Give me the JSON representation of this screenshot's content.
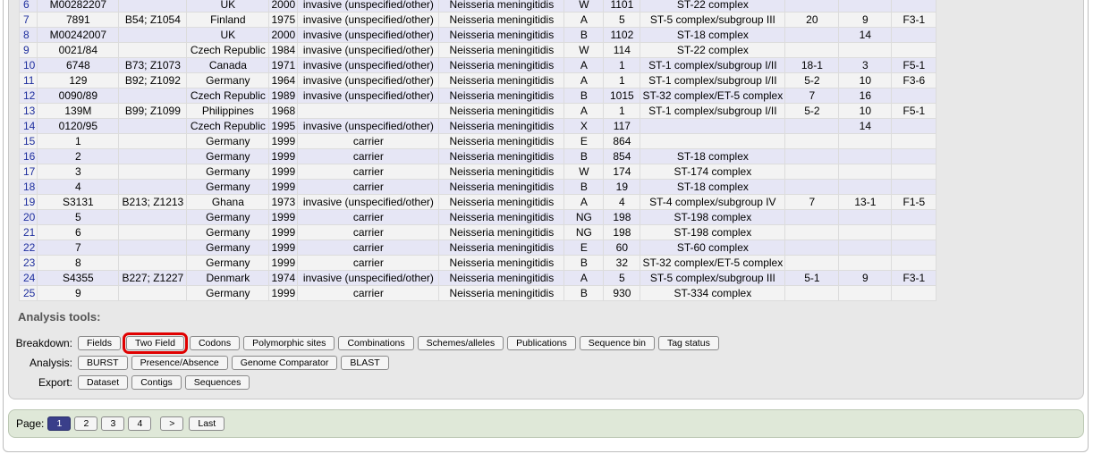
{
  "table": {
    "rows": [
      {
        "idx": "6",
        "id": "M00282207",
        "aliases": "",
        "country": "UK",
        "year": "2000",
        "disease": "invasive (unspecified/other)",
        "species": "Neisseria meningitidis",
        "serogroup": "W",
        "st": "1101",
        "complex": "ST-22 complex",
        "c1": "",
        "c2": "",
        "c3": ""
      },
      {
        "idx": "7",
        "id": "7891",
        "aliases": "B54; Z1054",
        "country": "Finland",
        "year": "1975",
        "disease": "invasive (unspecified/other)",
        "species": "Neisseria meningitidis",
        "serogroup": "A",
        "st": "5",
        "complex": "ST-5 complex/subgroup III",
        "c1": "20",
        "c2": "9",
        "c3": "F3-1"
      },
      {
        "idx": "8",
        "id": "M00242007",
        "aliases": "",
        "country": "UK",
        "year": "2000",
        "disease": "invasive (unspecified/other)",
        "species": "Neisseria meningitidis",
        "serogroup": "B",
        "st": "1102",
        "complex": "ST-18 complex",
        "c1": "",
        "c2": "14",
        "c3": ""
      },
      {
        "idx": "9",
        "id": "0021/84",
        "aliases": "",
        "country": "Czech Republic",
        "year": "1984",
        "disease": "invasive (unspecified/other)",
        "species": "Neisseria meningitidis",
        "serogroup": "W",
        "st": "114",
        "complex": "ST-22 complex",
        "c1": "",
        "c2": "",
        "c3": ""
      },
      {
        "idx": "10",
        "id": "6748",
        "aliases": "B73; Z1073",
        "country": "Canada",
        "year": "1971",
        "disease": "invasive (unspecified/other)",
        "species": "Neisseria meningitidis",
        "serogroup": "A",
        "st": "1",
        "complex": "ST-1 complex/subgroup I/II",
        "c1": "18-1",
        "c2": "3",
        "c3": "F5-1"
      },
      {
        "idx": "11",
        "id": "129",
        "aliases": "B92; Z1092",
        "country": "Germany",
        "year": "1964",
        "disease": "invasive (unspecified/other)",
        "species": "Neisseria meningitidis",
        "serogroup": "A",
        "st": "1",
        "complex": "ST-1 complex/subgroup I/II",
        "c1": "5-2",
        "c2": "10",
        "c3": "F3-6"
      },
      {
        "idx": "12",
        "id": "0090/89",
        "aliases": "",
        "country": "Czech Republic",
        "year": "1989",
        "disease": "invasive (unspecified/other)",
        "species": "Neisseria meningitidis",
        "serogroup": "B",
        "st": "1015",
        "complex": "ST-32 complex/ET-5 complex",
        "c1": "7",
        "c2": "16",
        "c3": ""
      },
      {
        "idx": "13",
        "id": "139M",
        "aliases": "B99; Z1099",
        "country": "Philippines",
        "year": "1968",
        "disease": "",
        "species": "Neisseria meningitidis",
        "serogroup": "A",
        "st": "1",
        "complex": "ST-1 complex/subgroup I/II",
        "c1": "5-2",
        "c2": "10",
        "c3": "F5-1"
      },
      {
        "idx": "14",
        "id": "0120/95",
        "aliases": "",
        "country": "Czech Republic",
        "year": "1995",
        "disease": "invasive (unspecified/other)",
        "species": "Neisseria meningitidis",
        "serogroup": "X",
        "st": "117",
        "complex": "",
        "c1": "",
        "c2": "14",
        "c3": ""
      },
      {
        "idx": "15",
        "id": "1",
        "aliases": "",
        "country": "Germany",
        "year": "1999",
        "disease": "carrier",
        "species": "Neisseria meningitidis",
        "serogroup": "E",
        "st": "864",
        "complex": "",
        "c1": "",
        "c2": "",
        "c3": ""
      },
      {
        "idx": "16",
        "id": "2",
        "aliases": "",
        "country": "Germany",
        "year": "1999",
        "disease": "carrier",
        "species": "Neisseria meningitidis",
        "serogroup": "B",
        "st": "854",
        "complex": "ST-18 complex",
        "c1": "",
        "c2": "",
        "c3": ""
      },
      {
        "idx": "17",
        "id": "3",
        "aliases": "",
        "country": "Germany",
        "year": "1999",
        "disease": "carrier",
        "species": "Neisseria meningitidis",
        "serogroup": "W",
        "st": "174",
        "complex": "ST-174 complex",
        "c1": "",
        "c2": "",
        "c3": ""
      },
      {
        "idx": "18",
        "id": "4",
        "aliases": "",
        "country": "Germany",
        "year": "1999",
        "disease": "carrier",
        "species": "Neisseria meningitidis",
        "serogroup": "B",
        "st": "19",
        "complex": "ST-18 complex",
        "c1": "",
        "c2": "",
        "c3": ""
      },
      {
        "idx": "19",
        "id": "S3131",
        "aliases": "B213; Z1213",
        "country": "Ghana",
        "year": "1973",
        "disease": "invasive (unspecified/other)",
        "species": "Neisseria meningitidis",
        "serogroup": "A",
        "st": "4",
        "complex": "ST-4 complex/subgroup IV",
        "c1": "7",
        "c2": "13-1",
        "c3": "F1-5"
      },
      {
        "idx": "20",
        "id": "5",
        "aliases": "",
        "country": "Germany",
        "year": "1999",
        "disease": "carrier",
        "species": "Neisseria meningitidis",
        "serogroup": "NG",
        "st": "198",
        "complex": "ST-198 complex",
        "c1": "",
        "c2": "",
        "c3": ""
      },
      {
        "idx": "21",
        "id": "6",
        "aliases": "",
        "country": "Germany",
        "year": "1999",
        "disease": "carrier",
        "species": "Neisseria meningitidis",
        "serogroup": "NG",
        "st": "198",
        "complex": "ST-198 complex",
        "c1": "",
        "c2": "",
        "c3": ""
      },
      {
        "idx": "22",
        "id": "7",
        "aliases": "",
        "country": "Germany",
        "year": "1999",
        "disease": "carrier",
        "species": "Neisseria meningitidis",
        "serogroup": "E",
        "st": "60",
        "complex": "ST-60 complex",
        "c1": "",
        "c2": "",
        "c3": ""
      },
      {
        "idx": "23",
        "id": "8",
        "aliases": "",
        "country": "Germany",
        "year": "1999",
        "disease": "carrier",
        "species": "Neisseria meningitidis",
        "serogroup": "B",
        "st": "32",
        "complex": "ST-32 complex/ET-5 complex",
        "c1": "",
        "c2": "",
        "c3": ""
      },
      {
        "idx": "24",
        "id": "S4355",
        "aliases": "B227; Z1227",
        "country": "Denmark",
        "year": "1974",
        "disease": "invasive (unspecified/other)",
        "species": "Neisseria meningitidis",
        "serogroup": "A",
        "st": "5",
        "complex": "ST-5 complex/subgroup III",
        "c1": "5-1",
        "c2": "9",
        "c3": "F3-1"
      },
      {
        "idx": "25",
        "id": "9",
        "aliases": "",
        "country": "Germany",
        "year": "1999",
        "disease": "carrier",
        "species": "Neisseria meningitidis",
        "serogroup": "B",
        "st": "930",
        "complex": "ST-334 complex",
        "c1": "",
        "c2": "",
        "c3": ""
      }
    ]
  },
  "tools": {
    "title": "Analysis tools:",
    "breakdown": {
      "label": "Breakdown:",
      "buttons": [
        "Fields",
        "Two Field",
        "Codons",
        "Polymorphic sites",
        "Combinations",
        "Schemes/alleles",
        "Publications",
        "Sequence bin",
        "Tag status"
      ]
    },
    "analysis": {
      "label": "Analysis:",
      "buttons": [
        "BURST",
        "Presence/Absence",
        "Genome Comparator",
        "BLAST"
      ]
    },
    "export": {
      "label": "Export:",
      "buttons": [
        "Dataset",
        "Contigs",
        "Sequences"
      ]
    },
    "highlighted": "Two Field",
    "highlight_color": "#e00000"
  },
  "pager": {
    "label": "Page:",
    "pages": [
      "1",
      "2",
      "3",
      "4"
    ],
    "current": "1",
    "next": ">",
    "last": "Last"
  }
}
